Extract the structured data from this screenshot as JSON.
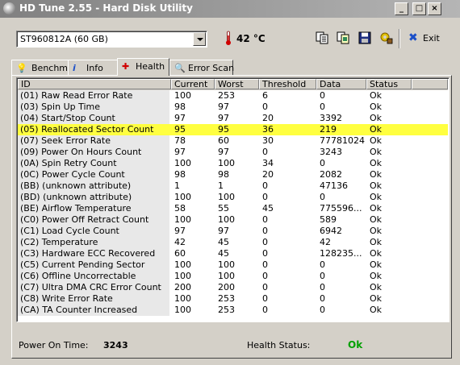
{
  "window": {
    "title": "HD Tune 2.55 - Hard Disk Utility",
    "min_label": "_",
    "restore_label": "□",
    "close_label": "×"
  },
  "toolbar": {
    "drive": "ST960812A (60 GB)",
    "temperature": "42 °C",
    "icons": [
      "copy-text-icon",
      "copy-screenshot-icon",
      "save-icon",
      "options-icon"
    ],
    "exit_label": "Exit"
  },
  "tabs": [
    {
      "label": "Benchmark",
      "icon": "benchmark-icon"
    },
    {
      "label": "Info",
      "icon": "info-icon"
    },
    {
      "label": "Health",
      "icon": "health-icon",
      "active": true
    },
    {
      "label": "Error Scan",
      "icon": "error-scan-icon"
    }
  ],
  "table": {
    "columns": [
      "ID",
      "Current",
      "Worst",
      "Threshold",
      "Data",
      "Status"
    ],
    "rows": [
      [
        "(01) Raw Read Error Rate",
        "100",
        "253",
        "6",
        "0",
        "Ok"
      ],
      [
        "(03) Spin Up Time",
        "98",
        "97",
        "0",
        "0",
        "Ok"
      ],
      [
        "(04) Start/Stop Count",
        "97",
        "97",
        "20",
        "3392",
        "Ok"
      ],
      [
        "(05) Reallocated Sector Count",
        "95",
        "95",
        "36",
        "219",
        "Ok"
      ],
      [
        "(07) Seek Error Rate",
        "78",
        "60",
        "30",
        "77781024",
        "Ok"
      ],
      [
        "(09) Power On Hours Count",
        "97",
        "97",
        "0",
        "3243",
        "Ok"
      ],
      [
        "(0A) Spin Retry Count",
        "100",
        "100",
        "34",
        "0",
        "Ok"
      ],
      [
        "(0C) Power Cycle Count",
        "98",
        "98",
        "20",
        "2082",
        "Ok"
      ],
      [
        "(BB) (unknown attribute)",
        "1",
        "1",
        "0",
        "47136",
        "Ok"
      ],
      [
        "(BD) (unknown attribute)",
        "100",
        "100",
        "0",
        "0",
        "Ok"
      ],
      [
        "(BE) Airflow Temperature",
        "58",
        "55",
        "45",
        "775596...",
        "Ok"
      ],
      [
        "(C0) Power Off Retract Count",
        "100",
        "100",
        "0",
        "589",
        "Ok"
      ],
      [
        "(C1) Load Cycle Count",
        "97",
        "97",
        "0",
        "6942",
        "Ok"
      ],
      [
        "(C2) Temperature",
        "42",
        "45",
        "0",
        "42",
        "Ok"
      ],
      [
        "(C3) Hardware ECC Recovered",
        "60",
        "45",
        "0",
        "128235...",
        "Ok"
      ],
      [
        "(C5) Current Pending Sector",
        "100",
        "100",
        "0",
        "0",
        "Ok"
      ],
      [
        "(C6) Offline Uncorrectable",
        "100",
        "100",
        "0",
        "0",
        "Ok"
      ],
      [
        "(C7) Ultra DMA CRC Error Count",
        "200",
        "200",
        "0",
        "0",
        "Ok"
      ],
      [
        "(C8) Write Error Rate",
        "100",
        "253",
        "0",
        "0",
        "Ok"
      ],
      [
        "(CA) TA Counter Increased",
        "100",
        "253",
        "0",
        "0",
        "Ok"
      ]
    ],
    "highlighted_row": 3,
    "highlight_color": "#ffff40"
  },
  "status": {
    "power_on_label": "Power On Time:",
    "power_on_value": "3243",
    "health_label": "Health Status:",
    "health_value": "Ok",
    "health_color": "#00a000"
  }
}
